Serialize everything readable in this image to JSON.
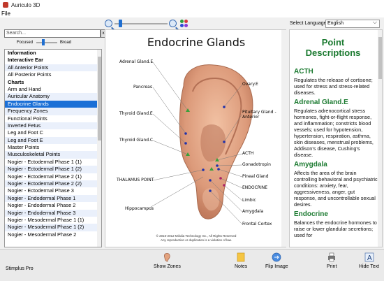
{
  "window": {
    "title": "Auriculo 3D"
  },
  "menu": {
    "file": "File"
  },
  "language": {
    "label": "Select Language:",
    "value": "English"
  },
  "search": {
    "placeholder": "Search...",
    "clear": "x"
  },
  "scope": {
    "focused": "Focused",
    "broad": "Broad"
  },
  "sidebar": {
    "items": [
      {
        "label": "Information",
        "type": "category"
      },
      {
        "label": "Interactive Ear",
        "type": "category"
      },
      {
        "label": "All Anterior Points",
        "type": "item"
      },
      {
        "label": "All Posterior Points",
        "type": "item"
      },
      {
        "label": "Charts",
        "type": "category"
      },
      {
        "label": "Arm and Hand",
        "type": "item"
      },
      {
        "label": "Auricular Anatomy",
        "type": "item"
      },
      {
        "label": "Endocrine Glands",
        "type": "selected"
      },
      {
        "label": "Frequency Zones",
        "type": "item"
      },
      {
        "label": "Functional Points",
        "type": "item"
      },
      {
        "label": "Inverted Fetus",
        "type": "item"
      },
      {
        "label": "Leg and Foot C",
        "type": "item"
      },
      {
        "label": "Leg and Foot E",
        "type": "item"
      },
      {
        "label": "Master Points",
        "type": "item"
      },
      {
        "label": "Musculoskeletal Points",
        "type": "item"
      },
      {
        "label": "Nogier - Ectodermal Phase 1 (1)",
        "type": "item"
      },
      {
        "label": "Nogier - Ectodermal Phase 1 (2)",
        "type": "item"
      },
      {
        "label": "Nogier - Ectodermal Phase 2 (1)",
        "type": "item"
      },
      {
        "label": "Nogier - Ectodermal Phase 2 (2)",
        "type": "item"
      },
      {
        "label": "Nogier - Ectodermal Phase 3",
        "type": "item"
      },
      {
        "label": "Nogier - Endodermal Phase 1",
        "type": "item"
      },
      {
        "label": "Nogier - Endodermal Phase 2",
        "type": "item"
      },
      {
        "label": "Nogier - Endodermal Phase 3",
        "type": "item"
      },
      {
        "label": "Nogier - Mesodermal Phase 1 (1)",
        "type": "item"
      },
      {
        "label": "Nogier - Mesodermal Phase 1 (2)",
        "type": "item"
      },
      {
        "label": "Nogier - Mesodermal Phase 2",
        "type": "item"
      }
    ]
  },
  "chart": {
    "title": "Endocrine Glands",
    "labels_left": [
      "Adrenal Gland.E",
      "Pancreas",
      "Thyroid Gland.E",
      "Thyroid Gland.C",
      "THALAMUS POINT",
      "Hippocampus"
    ],
    "labels_right": [
      "Ovary.E",
      "Pituitary Gland - Anterior",
      "ACTH",
      "Gonadotropin",
      "Pineal Gland",
      "ENDOCRINE",
      "Limbic",
      "Amygdala",
      "Frontal Cortex"
    ],
    "copyright_1": "© 2010-2012 Miridia Technology Inc., All Rights Reserved",
    "copyright_2": "Any reproduction or duplication is a violation of law."
  },
  "descriptions": {
    "heading": "Point Descriptions",
    "entries": [
      {
        "name": "ACTH",
        "text": "Regulates the release of cortisone; used for stress and stress-related diseases."
      },
      {
        "name": "Adrenal Gland.E",
        "text": "Regulates adrenocortical stress hormones, fight-or-flight response, and inflammation; constricts blood vessels; used for hypotension, hypertension, respiration, asthma, skin diseases, menstrual problems, Addison's disease, Cushing's disease."
      },
      {
        "name": "Amygdala",
        "text": "Affects the area of the brain controlling behavioral and psychiatric conditions: anxiety, fear, aggressiveness, anger, gut response, and uncontrollable sexual desires."
      },
      {
        "name": "Endocrine",
        "text": "Balances the endocrine hormones to raise or lower glandular secretions; used for"
      }
    ]
  },
  "bottombar": {
    "brand": "Stimplus Pro",
    "show_zones": "Show Zones",
    "notes": "Notes",
    "flip_image": "Flip Image",
    "print": "Print",
    "hide_text": "Hide Text"
  },
  "colors": {
    "accent": "#1a6fd6",
    "heading_green": "#1b7a30",
    "skin": "#e5a98b"
  }
}
